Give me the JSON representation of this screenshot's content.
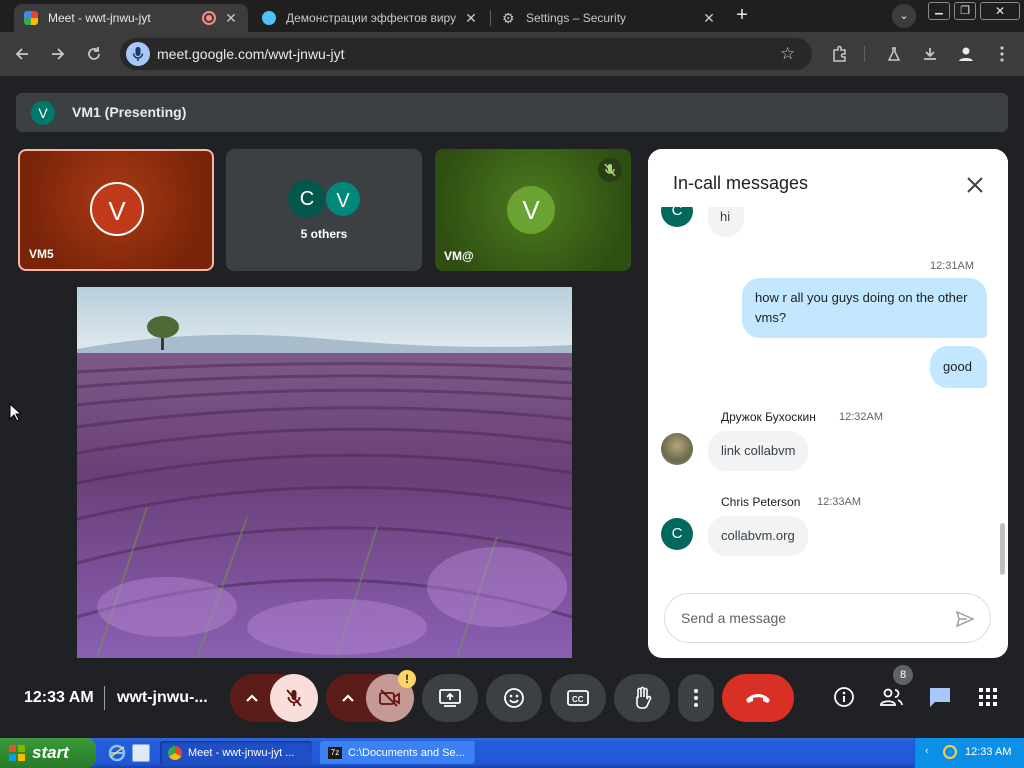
{
  "browser": {
    "tabs": [
      {
        "title": "Meet - wwt-jnwu-jyt",
        "active": true
      },
      {
        "title": "Демонстрации эффектов вирусов",
        "active": false
      },
      {
        "title": "Settings – Security",
        "active": false
      }
    ],
    "url": "meet.google.com/wwt-jnwu-jyt"
  },
  "meet": {
    "presenting_avatar": "V",
    "presenting_label": "VM1 (Presenting)",
    "tiles": [
      {
        "avatar": "V",
        "name": "VM5"
      },
      {
        "avatars": [
          "C",
          "V"
        ],
        "name": "5 others"
      },
      {
        "avatar": "V",
        "name": "VM@"
      }
    ],
    "chat": {
      "title": "In-call messages",
      "messages": [
        {
          "avatar": "C",
          "text": "hi"
        },
        {
          "time": "12:31AM",
          "outgoing": [
            "how r all you guys doing on the other vms?",
            "good"
          ]
        },
        {
          "sender": "Дружок Бухоскин",
          "time": "12:32AM",
          "text": "link collabvm"
        },
        {
          "sender": "Chris Peterson",
          "time": "12:33AM",
          "avatar": "C",
          "text": "collabvm.org"
        }
      ],
      "input_placeholder": "Send a message"
    },
    "bottom": {
      "clock": "12:33 AM",
      "meeting_code": "wwt-jnwu-...",
      "people_count": "8"
    }
  },
  "taskbar": {
    "start_label": "start",
    "tasks": [
      "Meet - wwt-jnwu-jyt ...",
      "C:\\Documents and Se..."
    ],
    "clock": "12:33 AM"
  },
  "colors": {
    "meet_bg": "#202124",
    "end_call_red": "#d93025",
    "chat_out_bubble": "#c2e7ff",
    "vm5_tile": "#8a2a0c",
    "vm_at_tile": "#3f6a1a"
  }
}
